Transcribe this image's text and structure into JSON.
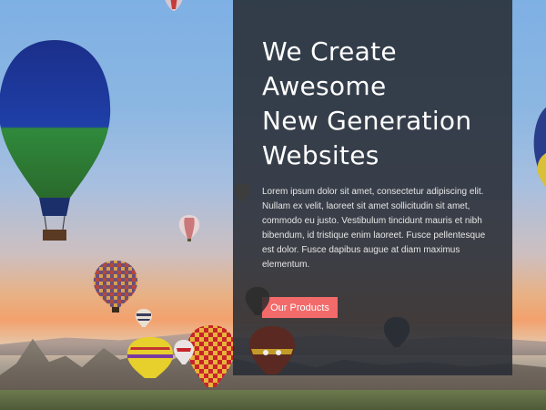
{
  "hero": {
    "headline_lines": [
      "We Create",
      "Awesome",
      "New Generation",
      "Websites"
    ],
    "body": "Lorem ipsum dolor sit amet, consectetur adipiscing elit. Nullam ex velit, laoreet sit amet sollicitudin sit amet, commodo eu justo. Vestibulum tincidunt mauris et nibh bibendum, id tristique enim laoreet. Fusce pellentesque est dolor. Fusce dapibus augue at diam maximus elementum.",
    "cta_label": "Our Products"
  },
  "colors": {
    "panel_bg": "#282c34",
    "cta_bg": "#f26a6a",
    "text": "#ffffff"
  },
  "background": {
    "scene_icon": "hot-air-balloons-photo"
  }
}
